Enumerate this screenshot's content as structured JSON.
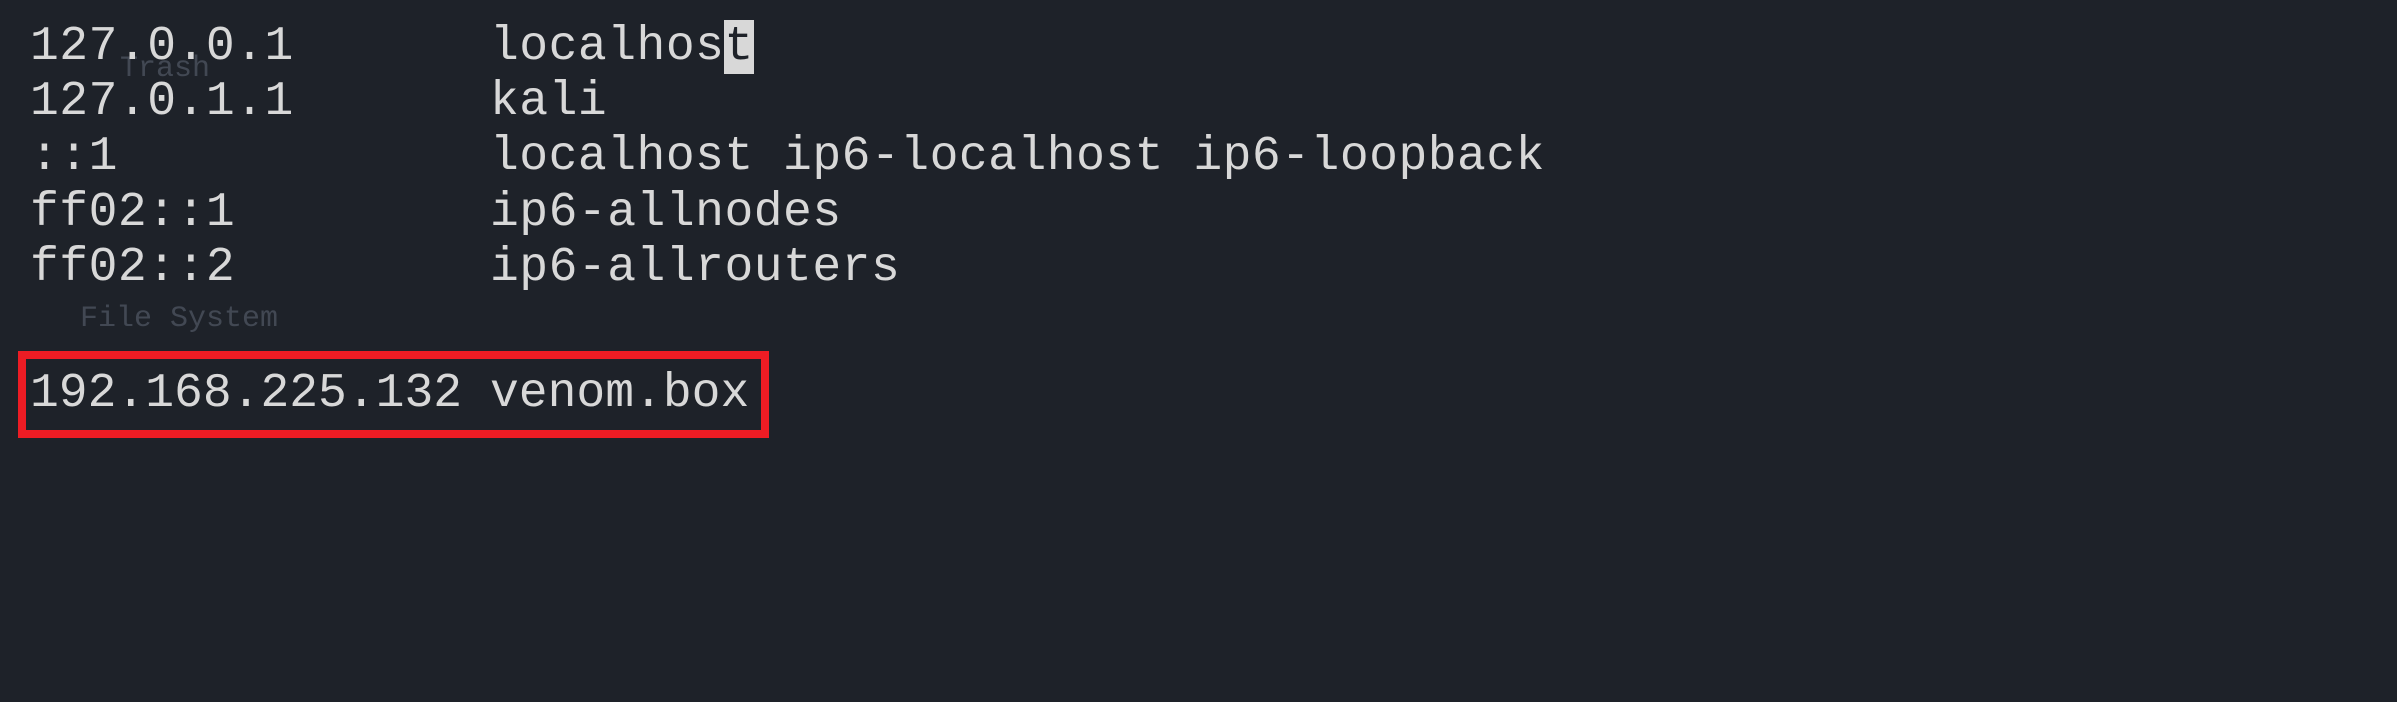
{
  "desktop": {
    "trash_label": "Trash",
    "filesystem_label": "File System"
  },
  "hosts": {
    "entries": [
      {
        "ip": "127.0.0.1",
        "names": "localhost",
        "cursor_on_last_char": true
      },
      {
        "ip": "127.0.1.1",
        "names": "kali"
      },
      {
        "ip": "::1",
        "names": "localhost ip6-localhost ip6-loopback"
      },
      {
        "ip": "ff02::1",
        "names": "ip6-allnodes"
      },
      {
        "ip": "ff02::2",
        "names": "ip6-allrouters"
      }
    ],
    "highlighted": {
      "ip": "192.168.225.132",
      "names": "venom.box"
    }
  },
  "colors": {
    "background": "#1e2229",
    "foreground": "#d8d8d8",
    "highlight_border": "#ed1c24"
  }
}
